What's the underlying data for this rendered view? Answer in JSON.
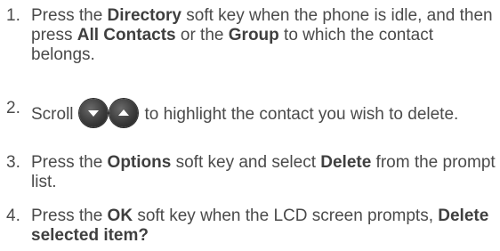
{
  "steps": [
    {
      "number": "1.",
      "parts": {
        "a": "Press the ",
        "b": "Directory",
        "c": " soft key when the phone is idle, and then press ",
        "d": "All Contacts",
        "e": " or the ",
        "f": "Group",
        "g": " to which the contact belongs."
      }
    },
    {
      "number": "2.",
      "parts": {
        "a": "Scroll",
        "b": "to highlight the contact you wish to delete."
      },
      "icons": [
        "down-arrow-key-icon",
        "up-arrow-key-icon"
      ]
    },
    {
      "number": "3.",
      "parts": {
        "a": "Press the ",
        "b": "Options",
        "c": " soft key and select ",
        "d": "Delete",
        "e": " from the prompt list."
      }
    },
    {
      "number": "4.",
      "parts": {
        "a": "Press the ",
        "b": "OK",
        "c": " soft key when the LCD screen prompts, ",
        "d": "Delete selected item?"
      }
    }
  ],
  "colors": {
    "text": "#4a4a4a",
    "bold_text": "#3f3f3f",
    "key_background": "#3b3b3b",
    "key_arrow": "#ffffff"
  }
}
